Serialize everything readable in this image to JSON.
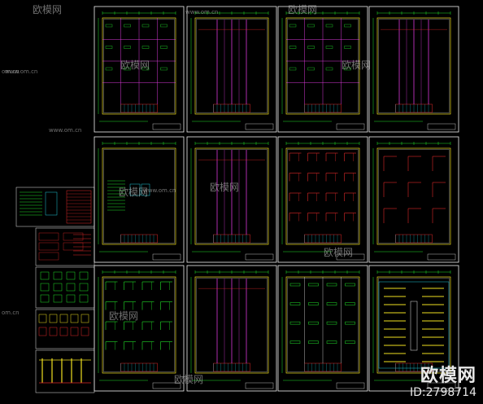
{
  "watermark": {
    "brand": "欧模网",
    "site": "www.om.cn",
    "site_short": "om.cn",
    "id_text": "ID:2798714"
  },
  "sheets": [
    {
      "name": "sheet-1",
      "kind": "grid-plan"
    },
    {
      "name": "sheet-2",
      "kind": "magenta-lines"
    },
    {
      "name": "sheet-3",
      "kind": "grid-plan"
    },
    {
      "name": "sheet-4",
      "kind": "magenta-lines"
    },
    {
      "name": "sheet-5",
      "kind": "notes"
    },
    {
      "name": "sheet-6",
      "kind": "magenta-lines"
    },
    {
      "name": "sheet-7",
      "kind": "red-dense"
    },
    {
      "name": "sheet-8",
      "kind": "red-sparse"
    },
    {
      "name": "sheet-9",
      "kind": "green-dense"
    },
    {
      "name": "sheet-10",
      "kind": "magenta-lines"
    },
    {
      "name": "sheet-11",
      "kind": "green-grid"
    },
    {
      "name": "sheet-12",
      "kind": "yellow-lights"
    }
  ],
  "colors": {
    "background": "#000000",
    "frame": "#f0f0f0",
    "green": "#22e22a",
    "magenta": "#d838d8",
    "red": "#e02828",
    "yellow": "#f0e020",
    "cyan": "#20c8d8",
    "white": "#e8e8e8"
  }
}
